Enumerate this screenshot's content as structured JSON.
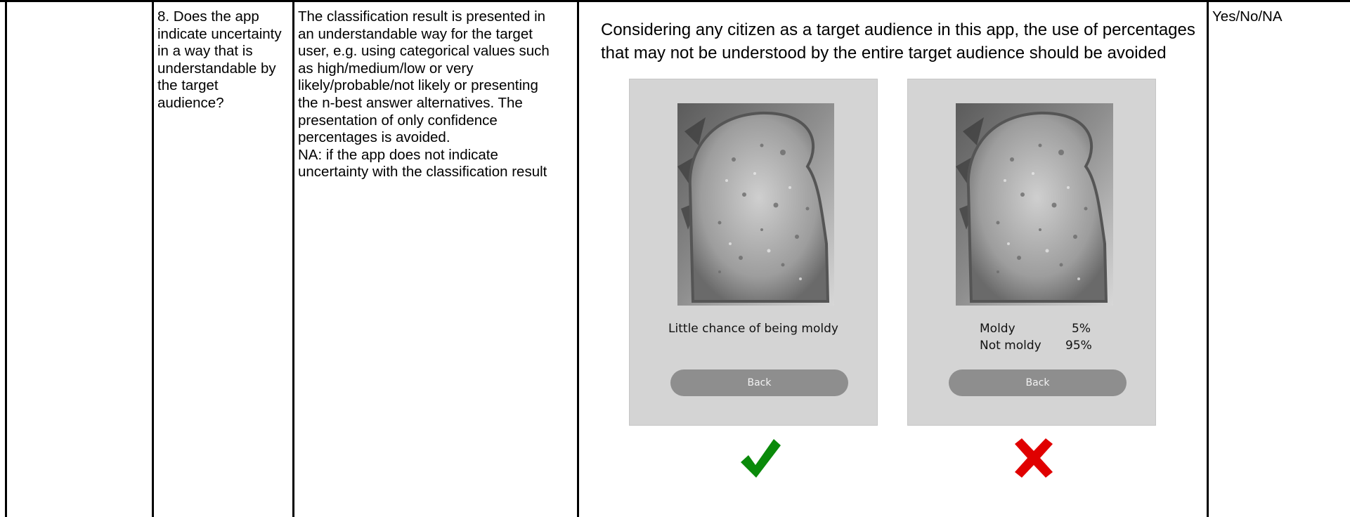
{
  "row": {
    "question": "8. Does the app\nindicate uncertainty\nin a way that is\nunderstandable by\nthe target\naudience?",
    "criterion": "The classification result is presented in\nan understandable way for the target\nuser, e.g. using categorical values such\nas high/medium/low or very\nlikely/probable/not likely or presenting\nthe n-best answer alternatives. The\npresentation of only confidence\npercentages is avoided.\nNA: if the app does not indicate\nuncertainty with the classification result",
    "example_intro": "Considering any citizen as a target audience in this app, the use of percentages that may not be understood by the entire target audience should be avoided",
    "answer_options": "Yes/No/NA"
  },
  "good_example": {
    "caption": "Little chance of being moldy",
    "button_label": "Back",
    "verdict_icon": "checkmark-icon",
    "verdict_color": "#0a8a0a"
  },
  "bad_example": {
    "results": [
      {
        "label": "Moldy",
        "value": "5%"
      },
      {
        "label": "Not moldy",
        "value": "95%"
      }
    ],
    "button_label": "Back",
    "verdict_icon": "cross-icon",
    "verdict_color": "#e00000"
  }
}
